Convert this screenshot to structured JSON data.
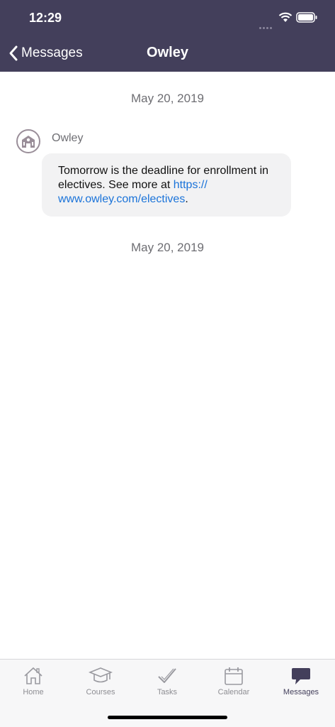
{
  "status": {
    "time": "12:29"
  },
  "nav": {
    "back_label": "Messages",
    "title": "Owley"
  },
  "thread": {
    "dates": [
      "May 20, 2019",
      "May 20, 2019"
    ],
    "message": {
      "sender": "Owley",
      "text_before": "Tomorrow is the deadline for enrollment in electives. See more at ",
      "link_line1": "https://",
      "link_line2": "www.owley.com/electives",
      "text_after": "."
    }
  },
  "tabs": [
    {
      "label": "Home",
      "icon": "home-icon"
    },
    {
      "label": "Courses",
      "icon": "graduation-cap-icon"
    },
    {
      "label": "Tasks",
      "icon": "checkmark-icon"
    },
    {
      "label": "Calendar",
      "icon": "calendar-icon"
    },
    {
      "label": "Messages",
      "icon": "chat-bubble-icon",
      "active": true
    }
  ],
  "colors": {
    "header": "#433f5b",
    "link": "#1a73d9",
    "bubble": "#f2f2f3"
  }
}
